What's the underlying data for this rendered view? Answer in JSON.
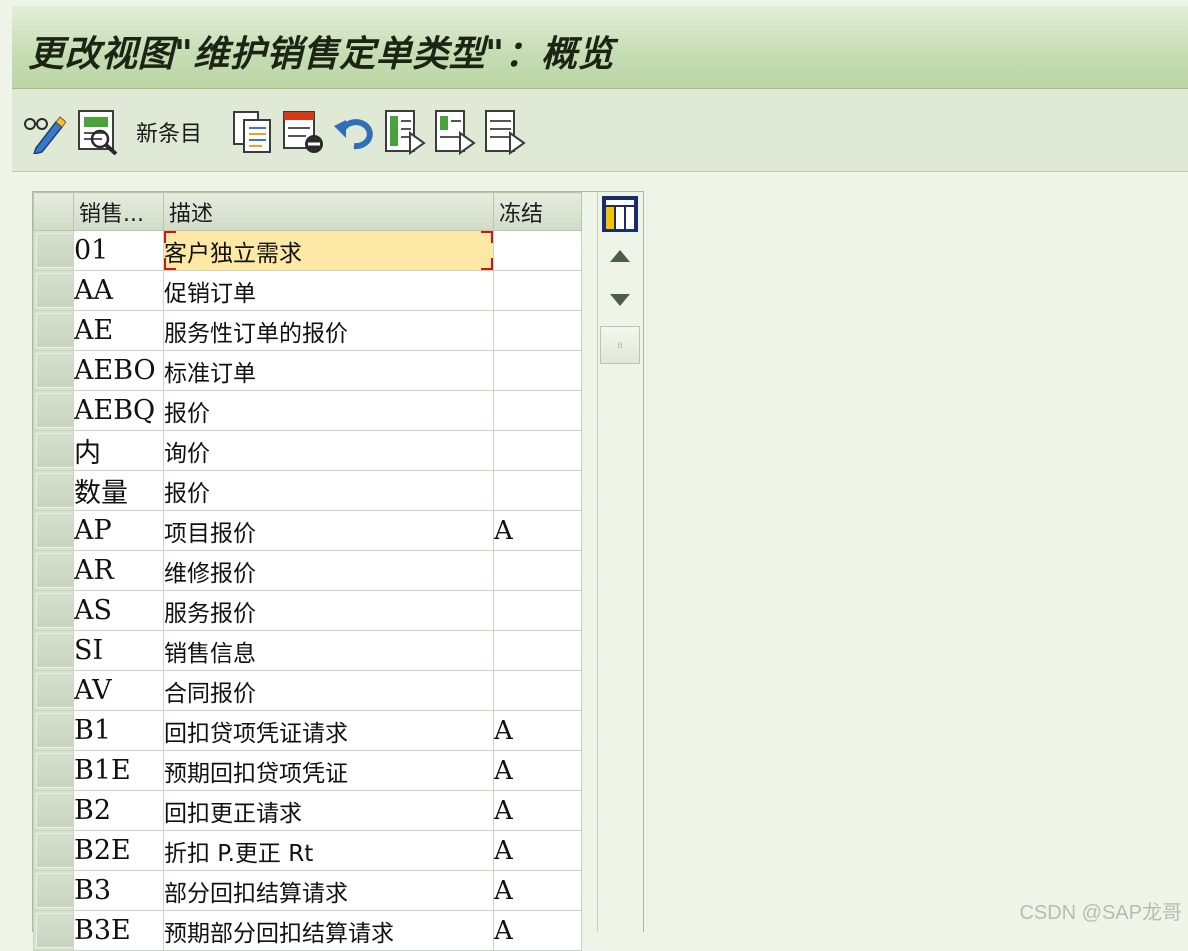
{
  "window": {
    "title": "更改视图\"维护销售定单类型\"：概览"
  },
  "toolbar": {
    "items": [
      {
        "icon": "display-change-icon"
      },
      {
        "icon": "select-all-icon"
      },
      {
        "label": "新条目"
      },
      {
        "icon": "copy-as-icon"
      },
      {
        "icon": "delete-icon"
      },
      {
        "icon": "undo-icon"
      },
      {
        "icon": "select-all-entries-icon"
      },
      {
        "icon": "select-block-icon"
      },
      {
        "icon": "deselect-all-icon"
      }
    ]
  },
  "table": {
    "columns": [
      "销售...",
      "描述",
      "冻结"
    ],
    "rows": [
      {
        "code": "01",
        "desc": "客户独立需求",
        "frozen": ""
      },
      {
        "code": "AA",
        "desc": "促销订单",
        "frozen": ""
      },
      {
        "code": "AE",
        "desc": "服务性订单的报价",
        "frozen": ""
      },
      {
        "code": "AEBO",
        "desc": "标准订单",
        "frozen": ""
      },
      {
        "code": "AEBQ",
        "desc": "报价",
        "frozen": ""
      },
      {
        "code": "内",
        "desc": "询价",
        "frozen": ""
      },
      {
        "code": "数量",
        "desc": "报价",
        "frozen": ""
      },
      {
        "code": "AP",
        "desc": "项目报价",
        "frozen": "A"
      },
      {
        "code": "AR",
        "desc": "维修报价",
        "frozen": ""
      },
      {
        "code": "AS",
        "desc": "服务报价",
        "frozen": ""
      },
      {
        "code": "SI",
        "desc": "销售信息",
        "frozen": ""
      },
      {
        "code": "AV",
        "desc": "合同报价",
        "frozen": ""
      },
      {
        "code": "B1",
        "desc": "回扣贷项凭证请求",
        "frozen": "A"
      },
      {
        "code": "B1E",
        "desc": "预期回扣贷项凭证",
        "frozen": "A"
      },
      {
        "code": "B2",
        "desc": "回扣更正请求",
        "frozen": "A"
      },
      {
        "code": "B2E",
        "desc": "折扣 P.更正 Rt",
        "frozen": "A"
      },
      {
        "code": "B3",
        "desc": "部分回扣结算请求",
        "frozen": "A"
      },
      {
        "code": "B3E",
        "desc": "预期部分回扣结算请求",
        "frozen": "A"
      }
    ]
  },
  "watermark": "CSDN @SAP龙哥",
  "colors": {
    "focus_cell": "#fde9a5",
    "focus_corner": "#d21414",
    "title_bar": "#c5dcb2"
  }
}
